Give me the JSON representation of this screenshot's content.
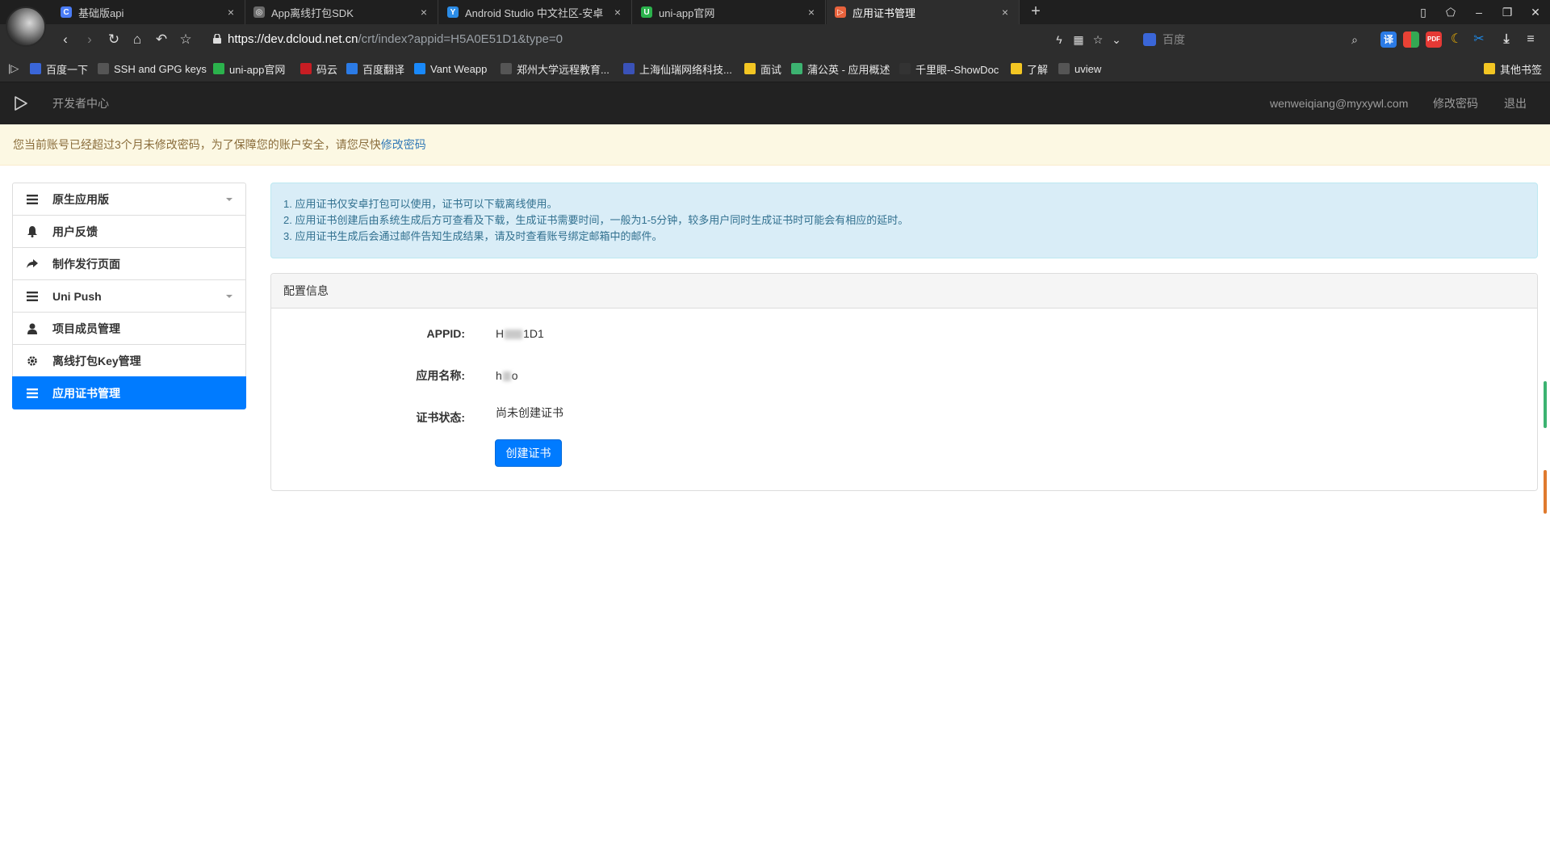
{
  "browser": {
    "tabs": [
      {
        "title": "基础版api",
        "color": "#4a7cf7",
        "glyph": "C"
      },
      {
        "title": "App离线打包SDK",
        "color": "#6b6b6b",
        "glyph": "◎"
      },
      {
        "title": "Android Studio 中文社区-安卓",
        "color": "#2b8ce6",
        "glyph": "Y"
      },
      {
        "title": "uni-app官网",
        "color": "#2bb24c",
        "glyph": "U"
      },
      {
        "title": "应用证书管理",
        "color": "#e8623c",
        "glyph": "▷"
      }
    ],
    "url_host": "https://dev.dcloud.net.cn",
    "url_path": "/crt/index?appid=H5A0E51D1&type=0",
    "search_placeholder": "百度",
    "bookmarks": [
      {
        "label": "百度一下",
        "color": "#3a66d8"
      },
      {
        "label": "SSH and GPG keys",
        "color": "#555555"
      },
      {
        "label": "uni-app官网",
        "color": "#2bb24c"
      },
      {
        "label": "码云",
        "color": "#c71d23"
      },
      {
        "label": "百度翻译",
        "color": "#2b7be6"
      },
      {
        "label": "Vant Weapp",
        "color": "#1989fa"
      },
      {
        "label": "郑州大学远程教育...",
        "color": "#555555"
      },
      {
        "label": "上海仙瑞网络科技...",
        "color": "#3a52b8"
      },
      {
        "label": "面试",
        "color": "#f3c623"
      },
      {
        "label": "蒲公英 - 应用概述",
        "color": "#3cb371"
      },
      {
        "label": "千里眼--ShowDoc",
        "color": "#333333"
      },
      {
        "label": "了解",
        "color": "#f3c623"
      },
      {
        "label": "uview",
        "color": "#555555"
      },
      {
        "label": "其他书签",
        "color": "#f3c623"
      }
    ]
  },
  "header": {
    "brand": "开发者中心",
    "user_email": "wenweiqiang@myxywl.com",
    "change_password": "修改密码",
    "logout": "退出"
  },
  "alert": {
    "text": "您当前账号已经超过3个月未修改密码，为了保障您的账户安全，请您尽快",
    "link": "修改密码"
  },
  "sidebar": {
    "items": [
      {
        "label": "原生应用版",
        "icon": "list-icon",
        "dropdown": true
      },
      {
        "label": "用户反馈",
        "icon": "bell-icon",
        "dropdown": false
      },
      {
        "label": "制作发行页面",
        "icon": "share-icon",
        "dropdown": false
      },
      {
        "label": "Uni Push",
        "icon": "list-icon",
        "dropdown": true
      },
      {
        "label": "项目成员管理",
        "icon": "user-icon",
        "dropdown": false
      },
      {
        "label": "离线打包Key管理",
        "icon": "gear-icon",
        "dropdown": false
      },
      {
        "label": "应用证书管理",
        "icon": "list-icon",
        "dropdown": false,
        "active": true
      }
    ]
  },
  "notice": {
    "lines": [
      "1. 应用证书仅安卓打包可以使用，证书可以下载离线使用。",
      "2. 应用证书创建后由系统生成后方可查看及下载，生成证书需要时间，一般为1-5分钟，较多用户同时生成证书时可能会有相应的延时。",
      "3. 应用证书生成后会通过邮件告知生成结果，请及时查看账号绑定邮箱中的邮件。"
    ]
  },
  "config": {
    "panel_title": "配置信息",
    "appid_label": "APPID:",
    "appid_prefix": "H",
    "appid_suffix": "1D1",
    "appname_label": "应用名称:",
    "appname_prefix": "h",
    "appname_suffix": "o",
    "status_label": "证书状态:",
    "status_value": "尚未创建证书",
    "create_button": "创建证书"
  }
}
